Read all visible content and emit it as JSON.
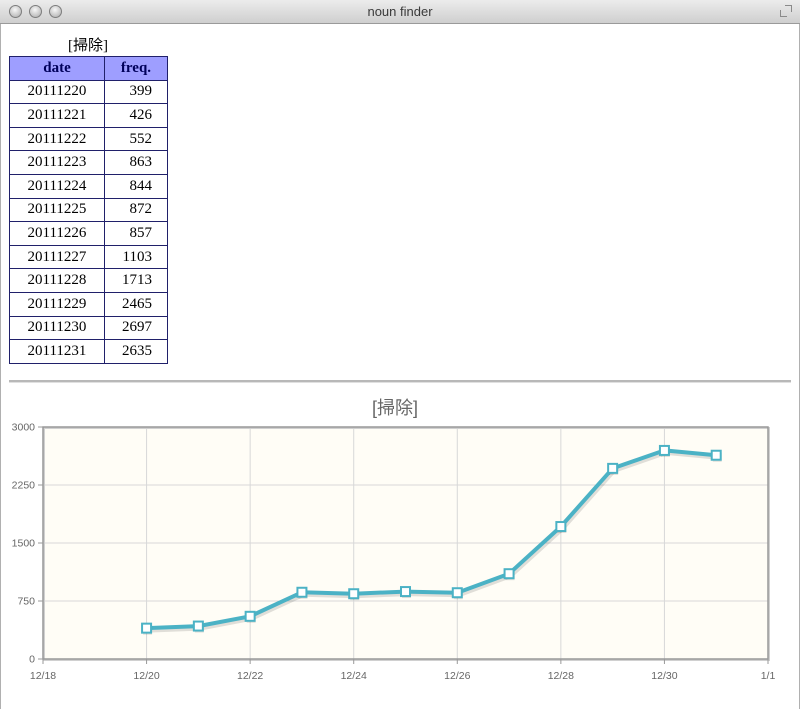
{
  "window": {
    "title": "noun finder"
  },
  "table": {
    "caption": "[掃除]",
    "headers": [
      "date",
      "freq."
    ],
    "rows": [
      [
        "20111220",
        "399"
      ],
      [
        "20111221",
        "426"
      ],
      [
        "20111222",
        "552"
      ],
      [
        "20111223",
        "863"
      ],
      [
        "20111224",
        "844"
      ],
      [
        "20111225",
        "872"
      ],
      [
        "20111226",
        "857"
      ],
      [
        "20111227",
        "1103"
      ],
      [
        "20111228",
        "1713"
      ],
      [
        "20111229",
        "2465"
      ],
      [
        "20111230",
        "2697"
      ],
      [
        "20111231",
        "2635"
      ]
    ]
  },
  "chart_data": {
    "type": "line",
    "title": "[掃除]",
    "x": [
      "12/20",
      "12/21",
      "12/22",
      "12/23",
      "12/24",
      "12/25",
      "12/26",
      "12/27",
      "12/28",
      "12/29",
      "12/30",
      "12/31"
    ],
    "series": [
      {
        "values": [
          399,
          426,
          552,
          863,
          844,
          872,
          857,
          1103,
          1713,
          2465,
          2697,
          2635
        ]
      }
    ],
    "x_tick_labels": [
      "12/18",
      "12/20",
      "12/22",
      "12/24",
      "12/26",
      "12/28",
      "12/30",
      "1/1"
    ],
    "y_ticks": [
      "0",
      "750",
      "1500",
      "2250",
      "3000"
    ],
    "ylim": [
      0,
      3000
    ],
    "xlim": [
      "12/18",
      "1/1"
    ],
    "grid": true,
    "line_color": "#4bb2c5",
    "plot_background": "#fffdf6"
  }
}
